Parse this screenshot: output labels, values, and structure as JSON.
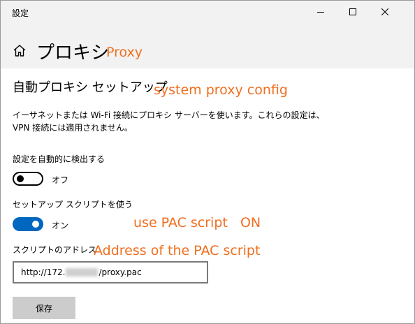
{
  "window": {
    "app_title": "設定",
    "controls": {
      "minimize": "minimize-icon",
      "maximize": "maximize-icon",
      "close": "close-icon"
    }
  },
  "header": {
    "home_icon": "home-icon",
    "title": "プロキシ",
    "annotation": "Proxy"
  },
  "section": {
    "title": "自動プロキシ セットアップ",
    "annotation": "system proxy config",
    "description": "イーサネットまたは Wi-Fi 接続にプロキシ サーバーを使います。これらの設定は、VPN 接続には適用されません。"
  },
  "auto_detect": {
    "label": "設定を自動的に検出する",
    "state_label": "オフ",
    "enabled": false
  },
  "setup_script": {
    "label": "セットアップ スクリプトを使う",
    "state_label": "オン",
    "enabled": true,
    "annotation": "use PAC script   ON"
  },
  "script_address": {
    "label": "スクリプトのアドレス",
    "annotation": "Address of the PAC script",
    "value_prefix": "http://172.",
    "value_suffix": "/proxy.pac"
  },
  "save_button": {
    "label": "保存"
  },
  "colors": {
    "accent": "#0067c0",
    "annotation": "#f06f1f",
    "header_bg": "#f2f2f2",
    "button_bg": "#cccccc"
  }
}
